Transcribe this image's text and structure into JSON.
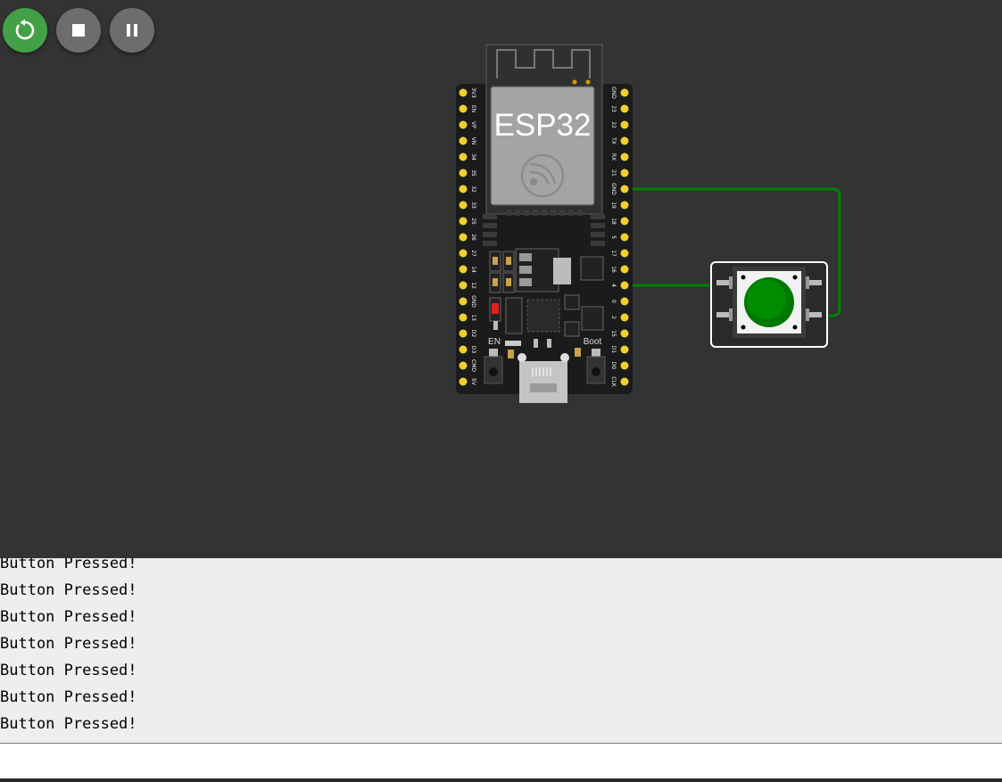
{
  "toolbar": {
    "restart_icon": "restart-icon",
    "stop_icon": "stop-icon",
    "pause_icon": "pause-icon",
    "restart_color": "#43a047",
    "button_color": "#6d6d6d"
  },
  "board": {
    "chip_label": "ESP32",
    "en_label": "EN",
    "boot_label": "Boot",
    "left_pins": [
      "3V3",
      "EN",
      "VP",
      "VN",
      "34",
      "35",
      "32",
      "33",
      "25",
      "26",
      "27",
      "14",
      "12",
      "GND",
      "13",
      "D2",
      "D3",
      "CMD",
      "5V"
    ],
    "right_pins": [
      "GND",
      "23",
      "22",
      "TX",
      "RX",
      "21",
      "GND",
      "19",
      "18",
      "5",
      "17",
      "16",
      "4",
      "0",
      "2",
      "15",
      "D1",
      "D0",
      "CLK"
    ]
  },
  "wires": {
    "color": "#008000"
  },
  "pushbutton": {
    "cap_color": "#008000"
  },
  "serial_monitor": {
    "lines": [
      "Button Pressed!",
      "Button Pressed!",
      "Button Pressed!",
      "Button Pressed!",
      "Button Pressed!",
      "Button Pressed!",
      "Button Pressed!"
    ],
    "input_value": ""
  }
}
